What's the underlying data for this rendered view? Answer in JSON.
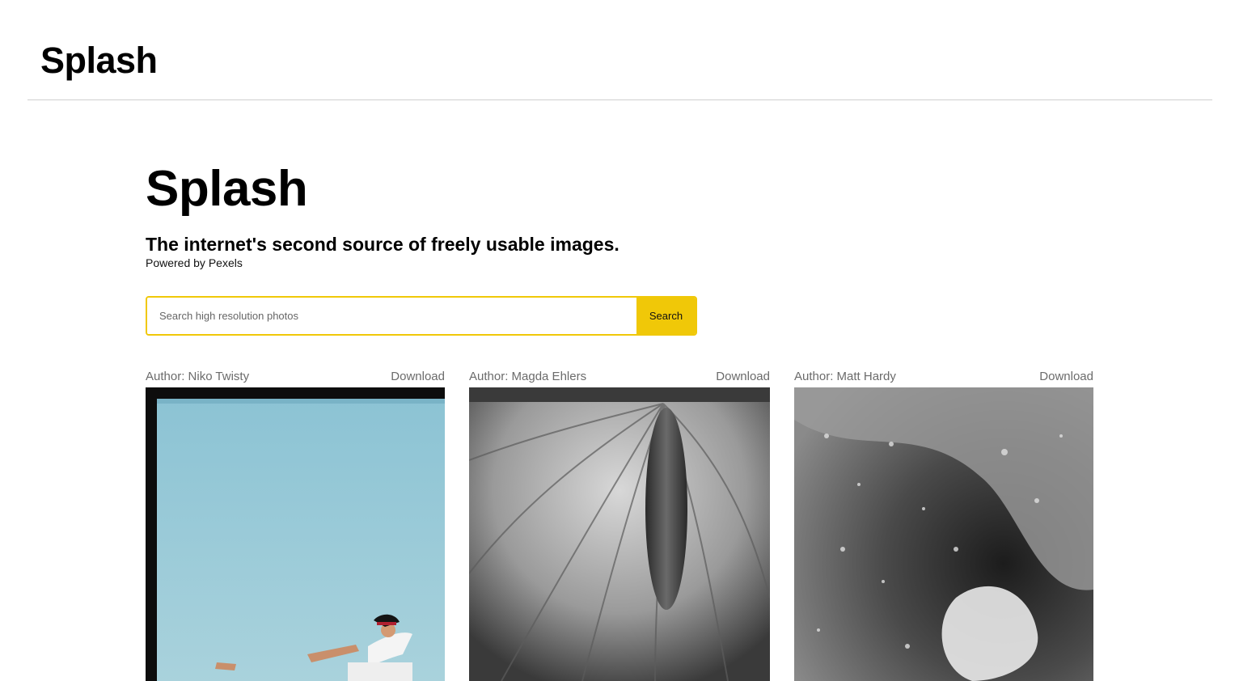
{
  "navbar": {
    "brand": "Splash"
  },
  "hero": {
    "title": "Splash",
    "tagline": "The internet's second source of freely usable images.",
    "powered_by": "Powered by Pexels"
  },
  "search": {
    "placeholder": "Search high resolution photos",
    "value": "",
    "button_label": "Search"
  },
  "photos": [
    {
      "author": "Author: Niko Twisty",
      "download_label": "Download",
      "subject": "skateboarder against blue sky"
    },
    {
      "author": "Author: Magda Ehlers",
      "download_label": "Download",
      "subject": "black and white anthurium flower"
    },
    {
      "author": "Author: Matt Hardy",
      "download_label": "Download",
      "subject": "black and white water splash"
    }
  ],
  "colors": {
    "accent": "#f0c808",
    "meta_text": "#6b6b6b",
    "divider": "#cfcfcf"
  }
}
